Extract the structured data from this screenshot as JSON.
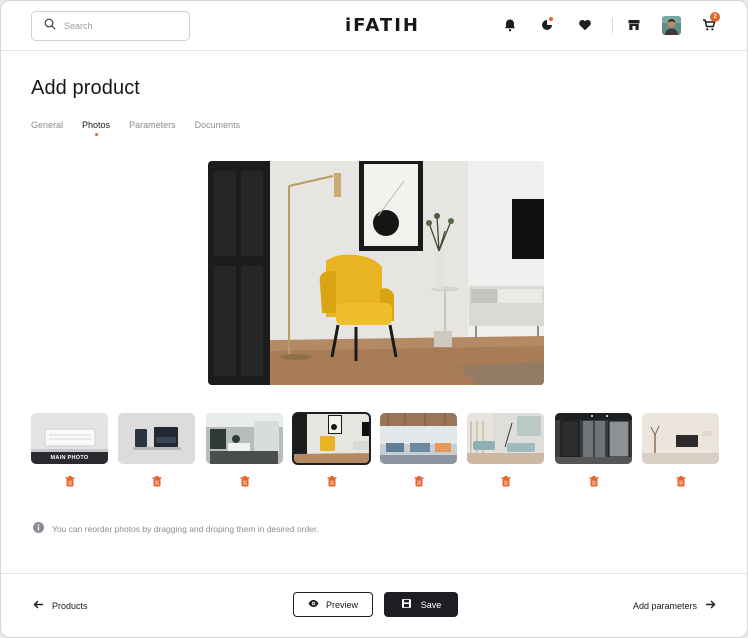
{
  "header": {
    "search_placeholder": "Search",
    "logo": "iFATIH",
    "cart_count": "2",
    "icons": [
      "search-icon",
      "bell-icon",
      "shopping-bag-icon",
      "heart-icon",
      "store-icon",
      "avatar",
      "cart-icon"
    ]
  },
  "page": {
    "title": "Add product",
    "tabs": [
      {
        "label": "General",
        "active": false
      },
      {
        "label": "Photos",
        "active": true
      },
      {
        "label": "Parameters",
        "active": false
      },
      {
        "label": "Documents",
        "active": false
      }
    ]
  },
  "photos": {
    "main_photo_label": "MAIN PHOTO",
    "count": 8,
    "selected_index": 3,
    "hint": "You can reorder photos by dragging and droping them in desired order."
  },
  "footer": {
    "back_label": "Products",
    "preview_label": "Preview",
    "save_label": "Save",
    "next_label": "Add parameters"
  },
  "colors": {
    "accent": "#e5662b",
    "dark": "#1d1d24",
    "muted": "#8a8d96"
  }
}
